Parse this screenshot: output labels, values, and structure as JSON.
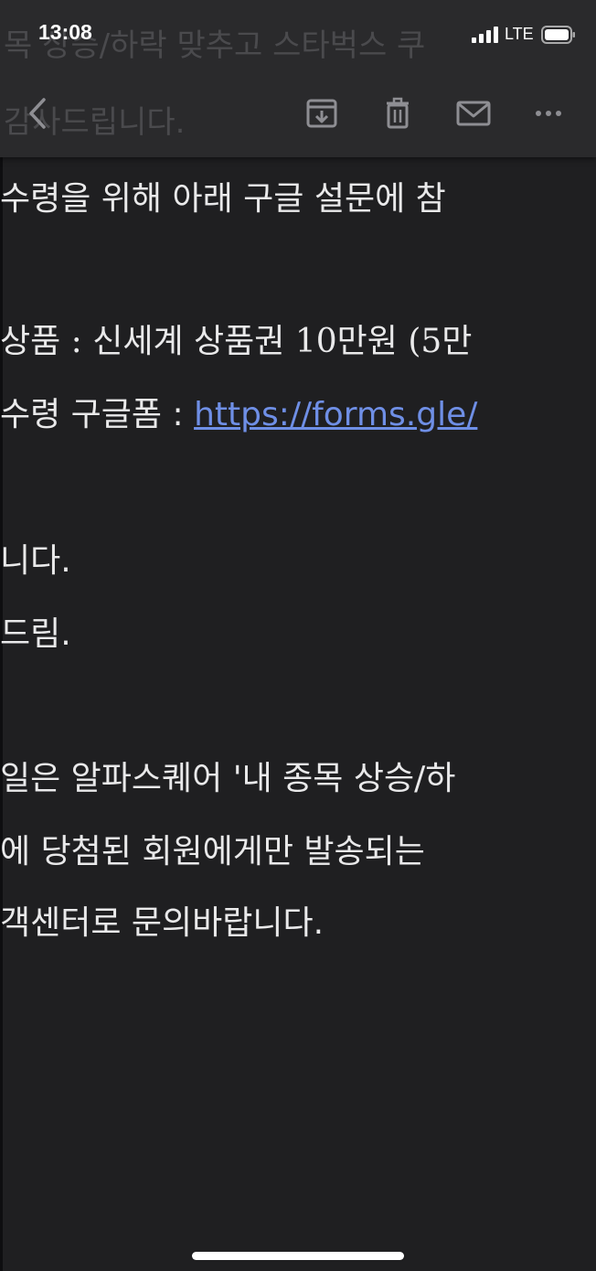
{
  "status_bar": {
    "time": "13:08",
    "network": "LTE",
    "icons": [
      "signal-icon",
      "battery-icon"
    ]
  },
  "header_ghost": {
    "line1": "목 상승/하락 맞추고 스타벅스 쿠",
    "line2": "감사드립니다."
  },
  "toolbar": {
    "icons": [
      "back-icon",
      "archive-icon",
      "trash-icon",
      "mail-icon",
      "more-icon"
    ]
  },
  "email_body": {
    "line1": "수령을 위해 아래 구글 설문에 참",
    "line2": "상품 : 신세계 상품권 10만원 (5만",
    "line3_prefix": "수령 구글폼 : ",
    "line3_link": "https://forms.gle/",
    "line4": "니다.",
    "line5": "드림.",
    "line6": "일은 알파스퀘어 '내 종목 상승/하",
    "line7": "에 당첨된 회원에게만 발송되는",
    "line8": "객센터로 문의바랍니다."
  },
  "colors": {
    "background": "#1f1f21",
    "toolbar_background": "#2a2a2c",
    "text": "#e9e9ea",
    "link": "#6f8fe6"
  }
}
